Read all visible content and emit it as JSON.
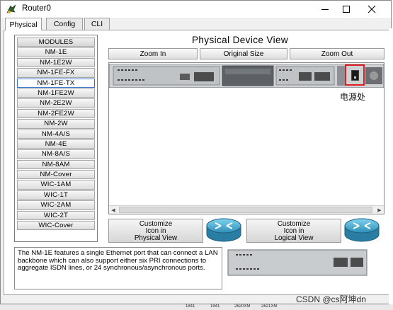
{
  "window": {
    "title": "Router0"
  },
  "tabs": [
    {
      "label": "Physical",
      "active": true
    },
    {
      "label": "Config",
      "active": false
    },
    {
      "label": "CLI",
      "active": false
    }
  ],
  "modules": {
    "header": "MODULES",
    "items": [
      "NM-1E",
      "NM-1E2W",
      "NM-1FE-FX",
      "NM-1FE-TX",
      "NM-1FE2W",
      "NM-2E2W",
      "NM-2FE2W",
      "NM-2W",
      "NM-4A/S",
      "NM-4E",
      "NM-8A/S",
      "NM-8AM",
      "NM-Cover",
      "WIC-1AM",
      "WIC-1T",
      "WIC-2AM",
      "WIC-2T",
      "WIC-Cover"
    ],
    "selected": "NM-1FE-TX"
  },
  "device_view": {
    "title": "Physical Device View",
    "zoom_in": "Zoom In",
    "original_size": "Original Size",
    "zoom_out": "Zoom Out",
    "power_annotation": "电源处",
    "annotation_color": "#e02020"
  },
  "customize": {
    "physical": [
      "Customize",
      "Icon in",
      "Physical View"
    ],
    "logical": [
      "Customize",
      "Icon in",
      "Logical View"
    ]
  },
  "description": "The NM-1E features a single Ethernet port that can connect a LAN backbone which can also support either six PRI connections to aggregate ISDN lines, or 24 synchronous/asynchronous ports.",
  "background": {
    "watermark": "CSDN @cs阿坤dn",
    "task_labels": [
      "1841",
      "1941",
      "2620XM",
      "2621XM"
    ]
  },
  "icons": {
    "app": "packet-tracer-icon",
    "router": "router-icon",
    "power": "power-switch-icon"
  }
}
